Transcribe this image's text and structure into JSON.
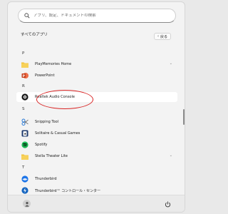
{
  "search": {
    "placeholder": "アプリ、設定、ドキュメントの検索"
  },
  "header": {
    "title": "すべてのアプリ",
    "back_label": "戻る",
    "back_chevron": "‹"
  },
  "sections": [
    {
      "letter": "P"
    },
    {
      "letter": "R"
    },
    {
      "letter": "S"
    },
    {
      "letter": "T"
    }
  ],
  "apps": [
    {
      "label": "PlayMemories Home",
      "icon": "folder-icon",
      "expandable": true
    },
    {
      "label": "PowerPoint",
      "icon": "powerpoint-icon",
      "expandable": false
    },
    {
      "label": "Realtek Audio Console",
      "icon": "realtek-icon",
      "expandable": false
    },
    {
      "label": "Snipping Tool",
      "icon": "snipping-tool-icon",
      "expandable": false
    },
    {
      "label": "Solitaire & Casual Games",
      "icon": "solitaire-icon",
      "expandable": false
    },
    {
      "label": "Spotify",
      "icon": "spotify-icon",
      "expandable": false
    },
    {
      "label": "Stella Theater Lite",
      "icon": "folder-icon",
      "expandable": true
    },
    {
      "label": "Thunderbird",
      "icon": "thunderbird-icon",
      "expandable": false
    },
    {
      "label": "Thunderbird™ コントロール・センター",
      "icon": "thunderbird-control-icon",
      "expandable": false
    }
  ],
  "colors": {
    "accent_annotation": "#d92424",
    "folder": "#f2c23b",
    "powerpoint": "#c43e1c",
    "spotify": "#1db954",
    "thunderbird": "#1a73e8"
  }
}
